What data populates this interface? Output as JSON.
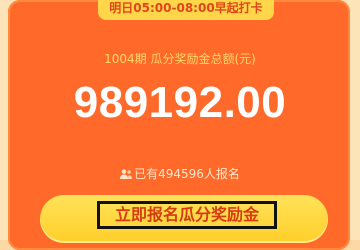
{
  "top_tab": {
    "text": "明日05:00-08:00早起打卡"
  },
  "prize": {
    "title": "1004期  瓜分奖励金总额(元)",
    "amount": "989192.00"
  },
  "signup": {
    "text": "已有494596人报名",
    "icon": "users-icon"
  },
  "cta": {
    "label": "立即报名瓜分奖励金"
  },
  "colors": {
    "card": "#ff6a2b",
    "tab": "#ffd54a",
    "button": "#ffd23a",
    "title": "#ffd76a",
    "button_text": "#d63b14"
  }
}
